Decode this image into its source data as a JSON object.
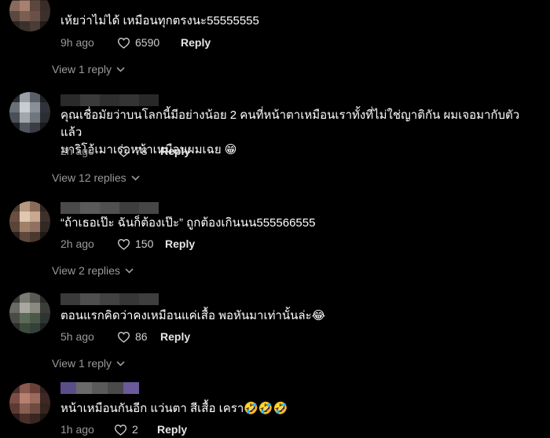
{
  "comments": [
    {
      "text": "เห้ยว่าไม่ได้ เหมือนทุกตรงนะ55555555",
      "time": "9h ago",
      "likes": "6590",
      "reply_label": "Reply",
      "view_replies": "View 1 reply",
      "avatar_colors": [
        "#3a2e2a",
        "#6b5048",
        "#4a3a36",
        "#2a2220",
        "#8a6a5c",
        "#a88070",
        "#5c463e",
        "#3a2c28",
        "#5a4840",
        "#7a5e52",
        "#6a5048",
        "#3c302c",
        "#2c2420",
        "#3a302c",
        "#4a3c36",
        "#201a18"
      ]
    },
    {
      "text": "คุณเชื่อมัยว่าบนโลกนี้มีอย่างน้อย 2 คนที่หน้าตาเหมือนเราทั้งที่ไม่ใช่ญาติกัน ผมเจอมากับตัวแล้ว\nมาริโอ้เมาเร่อหน้าเหมือนผมเฉย 😁",
      "time": "2h ago",
      "likes": "78",
      "reply_label": "Reply",
      "view_replies": "View 12 replies",
      "avatar_colors": [
        "#2a2e34",
        "#9aa0a8",
        "#5a6068",
        "#1e2024",
        "#6a7078",
        "#c8cdd2",
        "#8a9098",
        "#30343a",
        "#4a5058",
        "#a0a6ae",
        "#70767e",
        "#2a2e32",
        "#1c1e22",
        "#50565e",
        "#3a3e44",
        "#16181a"
      ]
    },
    {
      "text": "“ถ้าเธอเป๊ะ ฉันก็ต้องเป๊ะ” ถูกต้องเกินนน555566555",
      "time": "2h ago",
      "likes": "150",
      "reply_label": "Reply",
      "view_replies": "View 2 replies",
      "avatar_colors": [
        "#4a3a32",
        "#b89880",
        "#8a6a58",
        "#2e2420",
        "#6a4e40",
        "#e0c8b0",
        "#c8a890",
        "#3e302a",
        "#5a4438",
        "#a08068",
        "#907060",
        "#322824",
        "#2a201c",
        "#5e483c",
        "#4a382e",
        "#1e1816"
      ]
    },
    {
      "text": "ตอนแรกคิดว่าคงเหมือนแค่เสื้อ พอหันมาเท่านั้นล่ะ😂",
      "time": "5h ago",
      "likes": "86",
      "reply_label": "Reply",
      "view_replies": "View 1 reply",
      "avatar_colors": [
        "#3a3a36",
        "#7a7a72",
        "#5a5a54",
        "#2a2a28",
        "#6a6a64",
        "#a8a8a0",
        "#8a8a82",
        "#3c3c38",
        "#4a4a46",
        "#5c6a5a",
        "#4a5848",
        "#2e3430",
        "#2a3028",
        "#3e4a3c",
        "#34403a",
        "#1e221e"
      ]
    },
    {
      "text": "หน้าเหมือนกันอีก แว่นตา สีเสื้อ เครา🤣🤣🤣",
      "time": "1h ago",
      "likes": "2",
      "reply_label": "Reply",
      "avatar_colors": [
        "#4a2e2a",
        "#8a5a4e",
        "#6a4038",
        "#32201c",
        "#7a4e44",
        "#b88070",
        "#9a6a5c",
        "#3e2824",
        "#5a3a32",
        "#8a6054",
        "#6e4a40",
        "#36241e",
        "#2a1c18",
        "#4a3028",
        "#3a2620",
        "#1e1412"
      ]
    }
  ],
  "username_blur_colors": [
    [
      "#2a2a2a",
      "#3a3a3a",
      "#2e2e2e",
      "#343434",
      "#282828"
    ],
    [
      "#4a4a4a",
      "#5a5a5a",
      "#505050",
      "#3e3e3e",
      "#464646"
    ],
    [
      "#3a3a3a",
      "#4e4e4e",
      "#424242",
      "#363636",
      "#3e3e3e"
    ],
    [
      "#3e3e3e",
      "#505050",
      "#464646",
      "#3a3a3a",
      "#444444"
    ],
    [
      "#5a4e8a",
      "#6a6a6a",
      "#5a5a5a",
      "#4a4a4a",
      "#6a5a9a"
    ]
  ]
}
